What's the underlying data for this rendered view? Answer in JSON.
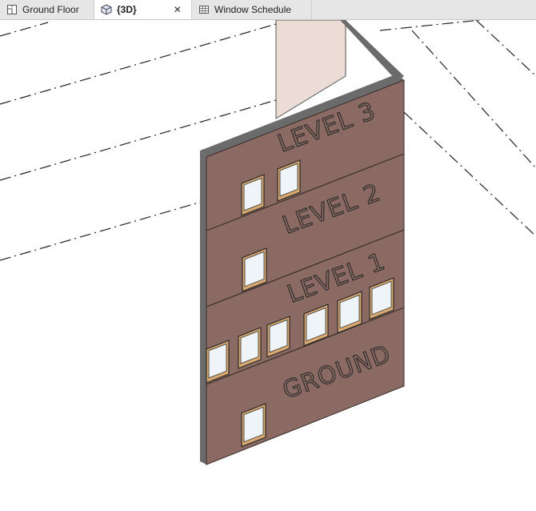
{
  "tabs": [
    {
      "label": "Ground Floor",
      "icon": "floor-plan-icon",
      "active": false
    },
    {
      "label": "{3D}",
      "icon": "3d-view-icon",
      "active": true,
      "closable": true
    },
    {
      "label": "Window Schedule",
      "icon": "schedule-table-icon",
      "active": false
    }
  ],
  "close_glyph": "✕",
  "levels": [
    "LEVEL 3",
    "LEVEL 2",
    "LEVEL 1",
    "GROUND"
  ],
  "colors": {
    "wall_face": "#8a6a62",
    "wall_edge": "#6b6b6b",
    "back_wall": "#ecdcd6",
    "window_frame": "#d8a870",
    "glass": "#eef4f8"
  }
}
